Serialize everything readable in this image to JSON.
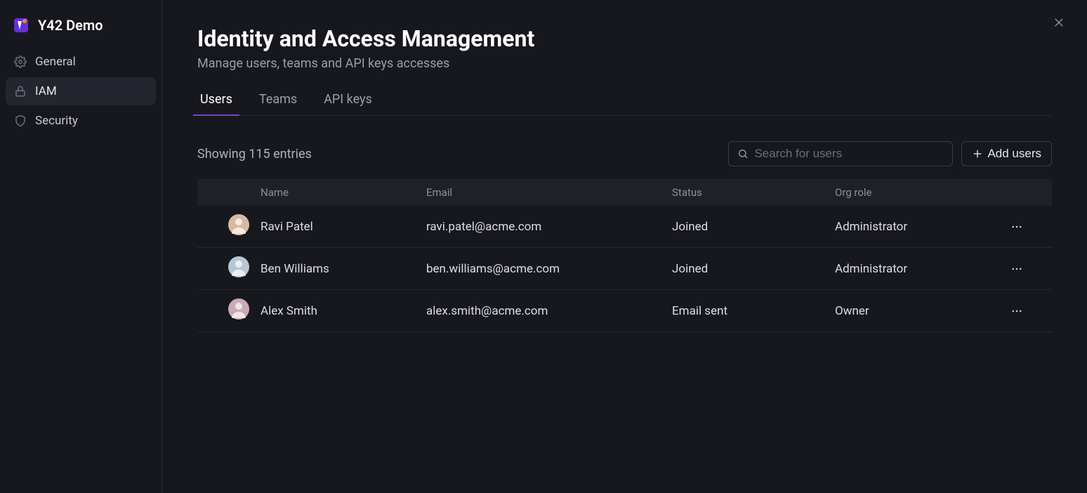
{
  "brand": {
    "title": "Y42 Demo"
  },
  "sidebar": {
    "items": [
      {
        "id": "general",
        "label": "General",
        "icon": "gear-icon",
        "active": false
      },
      {
        "id": "iam",
        "label": "IAM",
        "icon": "lock-icon",
        "active": true
      },
      {
        "id": "security",
        "label": "Security",
        "icon": "shield-icon",
        "active": false
      }
    ]
  },
  "header": {
    "title": "Identity and Access Management",
    "subtitle": "Manage users, teams and API keys accesses"
  },
  "tabs": [
    {
      "id": "users",
      "label": "Users",
      "active": true
    },
    {
      "id": "teams",
      "label": "Teams",
      "active": false
    },
    {
      "id": "apikeys",
      "label": "API keys",
      "active": false
    }
  ],
  "toolbar": {
    "entries_text": "Showing 115 entries",
    "search_placeholder": "Search for users",
    "add_users_label": "Add users"
  },
  "table": {
    "columns": {
      "name": "Name",
      "email": "Email",
      "status": "Status",
      "role": "Org role"
    },
    "rows": [
      {
        "name": "Ravi Patel",
        "email": "ravi.patel@acme.com",
        "status": "Joined",
        "role": "Administrator",
        "avatar_bg": "#d9b9a0"
      },
      {
        "name": "Ben Williams",
        "email": "ben.williams@acme.com",
        "status": "Joined",
        "role": "Administrator",
        "avatar_bg": "#b7c7d6"
      },
      {
        "name": "Alex Smith",
        "email": "alex.smith@acme.com",
        "status": "Email sent",
        "role": "Owner",
        "avatar_bg": "#c9aab6"
      }
    ]
  }
}
